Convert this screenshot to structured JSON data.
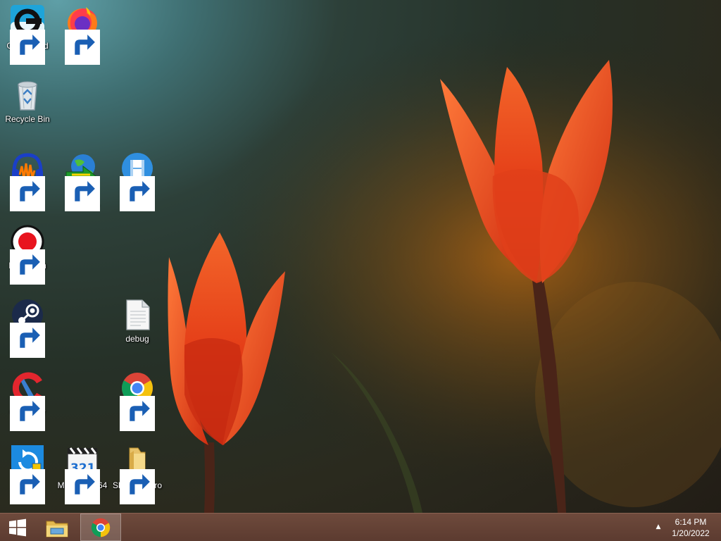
{
  "desktop": {
    "icons": [
      {
        "label": "GameLoad",
        "icon": "gameload-icon",
        "shortcut": true
      },
      {
        "label": "Firefox",
        "icon": "firefox-icon",
        "shortcut": true
      },
      {
        "label": "Recycle Bin",
        "icon": "recycle-bin-icon",
        "shortcut": false
      },
      {
        "label": "Audacity",
        "icon": "audacity-icon",
        "shortcut": true
      },
      {
        "label": "Internet Downlo...",
        "icon": "internet-download-manager-icon",
        "shortcut": true
      },
      {
        "label": "Bandicut",
        "icon": "bandicut-icon",
        "shortcut": true
      },
      {
        "label": "Bandicam",
        "icon": "bandicam-icon",
        "shortcut": true
      },
      {
        "label": "Steam",
        "icon": "steam-icon",
        "shortcut": true
      },
      {
        "label": "debug",
        "icon": "text-file-icon",
        "shortcut": false
      },
      {
        "label": "CCleaner",
        "icon": "ccleaner-icon",
        "shortcut": true
      },
      {
        "label": "Google Chrome",
        "icon": "chrome-icon",
        "shortcut": true
      },
      {
        "label": "AOMEI OneKe...",
        "icon": "aomei-icon",
        "shortcut": true
      },
      {
        "label": "MPC-HC x64",
        "icon": "mpc-hc-icon",
        "shortcut": true
      },
      {
        "label": "SkyDrive Pro 2018",
        "icon": "folder-icon",
        "shortcut": true
      }
    ]
  },
  "taskbar": {
    "start_icon": "windows-logo-icon",
    "pinned": [
      {
        "name": "File Explorer",
        "icon": "file-explorer-icon"
      },
      {
        "name": "Google Chrome",
        "icon": "chrome-icon",
        "active": true
      }
    ],
    "tray_arrow": "▲",
    "time": "6:14 PM",
    "date": "1/20/2022"
  },
  "colors": {
    "taskbar": "#5f3e32",
    "tulip": "#e8421e"
  }
}
